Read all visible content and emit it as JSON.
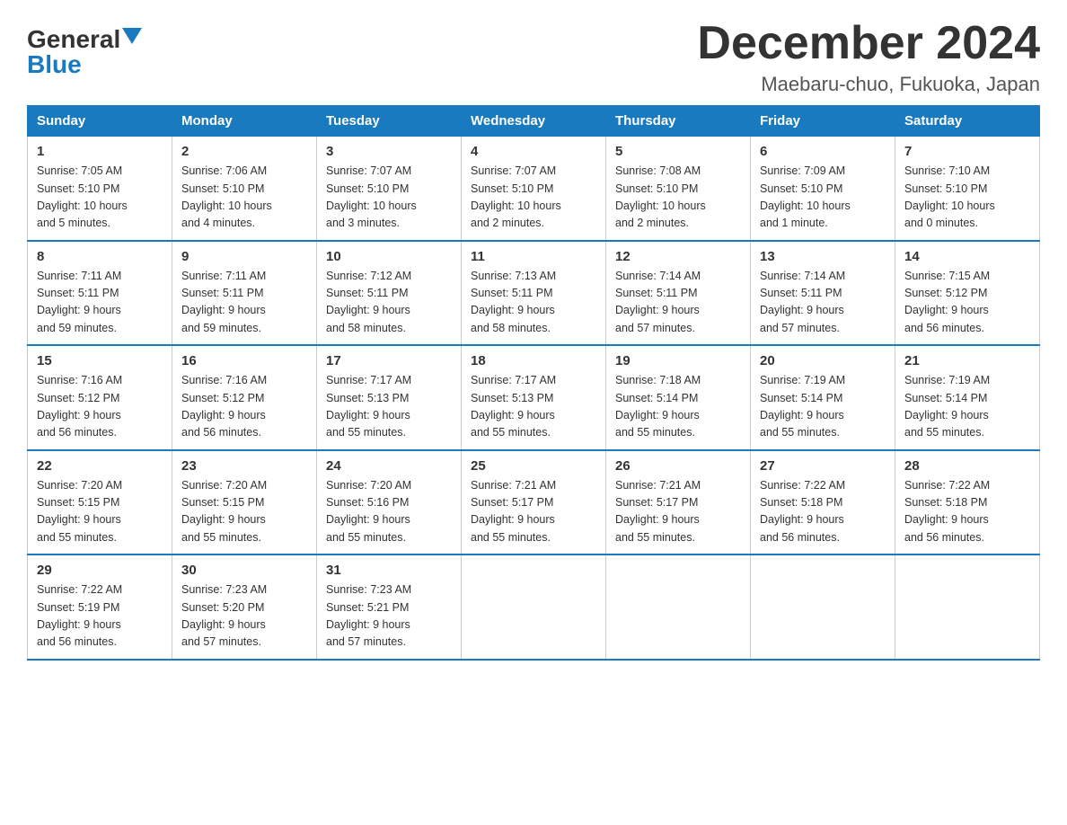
{
  "header": {
    "logo_general": "General",
    "logo_blue": "Blue",
    "title": "December 2024",
    "location": "Maebaru-chuo, Fukuoka, Japan"
  },
  "days_of_week": [
    "Sunday",
    "Monday",
    "Tuesday",
    "Wednesday",
    "Thursday",
    "Friday",
    "Saturday"
  ],
  "weeks": [
    [
      {
        "day": "1",
        "info": "Sunrise: 7:05 AM\nSunset: 5:10 PM\nDaylight: 10 hours\nand 5 minutes."
      },
      {
        "day": "2",
        "info": "Sunrise: 7:06 AM\nSunset: 5:10 PM\nDaylight: 10 hours\nand 4 minutes."
      },
      {
        "day": "3",
        "info": "Sunrise: 7:07 AM\nSunset: 5:10 PM\nDaylight: 10 hours\nand 3 minutes."
      },
      {
        "day": "4",
        "info": "Sunrise: 7:07 AM\nSunset: 5:10 PM\nDaylight: 10 hours\nand 2 minutes."
      },
      {
        "day": "5",
        "info": "Sunrise: 7:08 AM\nSunset: 5:10 PM\nDaylight: 10 hours\nand 2 minutes."
      },
      {
        "day": "6",
        "info": "Sunrise: 7:09 AM\nSunset: 5:10 PM\nDaylight: 10 hours\nand 1 minute."
      },
      {
        "day": "7",
        "info": "Sunrise: 7:10 AM\nSunset: 5:10 PM\nDaylight: 10 hours\nand 0 minutes."
      }
    ],
    [
      {
        "day": "8",
        "info": "Sunrise: 7:11 AM\nSunset: 5:11 PM\nDaylight: 9 hours\nand 59 minutes."
      },
      {
        "day": "9",
        "info": "Sunrise: 7:11 AM\nSunset: 5:11 PM\nDaylight: 9 hours\nand 59 minutes."
      },
      {
        "day": "10",
        "info": "Sunrise: 7:12 AM\nSunset: 5:11 PM\nDaylight: 9 hours\nand 58 minutes."
      },
      {
        "day": "11",
        "info": "Sunrise: 7:13 AM\nSunset: 5:11 PM\nDaylight: 9 hours\nand 58 minutes."
      },
      {
        "day": "12",
        "info": "Sunrise: 7:14 AM\nSunset: 5:11 PM\nDaylight: 9 hours\nand 57 minutes."
      },
      {
        "day": "13",
        "info": "Sunrise: 7:14 AM\nSunset: 5:11 PM\nDaylight: 9 hours\nand 57 minutes."
      },
      {
        "day": "14",
        "info": "Sunrise: 7:15 AM\nSunset: 5:12 PM\nDaylight: 9 hours\nand 56 minutes."
      }
    ],
    [
      {
        "day": "15",
        "info": "Sunrise: 7:16 AM\nSunset: 5:12 PM\nDaylight: 9 hours\nand 56 minutes."
      },
      {
        "day": "16",
        "info": "Sunrise: 7:16 AM\nSunset: 5:12 PM\nDaylight: 9 hours\nand 56 minutes."
      },
      {
        "day": "17",
        "info": "Sunrise: 7:17 AM\nSunset: 5:13 PM\nDaylight: 9 hours\nand 55 minutes."
      },
      {
        "day": "18",
        "info": "Sunrise: 7:17 AM\nSunset: 5:13 PM\nDaylight: 9 hours\nand 55 minutes."
      },
      {
        "day": "19",
        "info": "Sunrise: 7:18 AM\nSunset: 5:14 PM\nDaylight: 9 hours\nand 55 minutes."
      },
      {
        "day": "20",
        "info": "Sunrise: 7:19 AM\nSunset: 5:14 PM\nDaylight: 9 hours\nand 55 minutes."
      },
      {
        "day": "21",
        "info": "Sunrise: 7:19 AM\nSunset: 5:14 PM\nDaylight: 9 hours\nand 55 minutes."
      }
    ],
    [
      {
        "day": "22",
        "info": "Sunrise: 7:20 AM\nSunset: 5:15 PM\nDaylight: 9 hours\nand 55 minutes."
      },
      {
        "day": "23",
        "info": "Sunrise: 7:20 AM\nSunset: 5:15 PM\nDaylight: 9 hours\nand 55 minutes."
      },
      {
        "day": "24",
        "info": "Sunrise: 7:20 AM\nSunset: 5:16 PM\nDaylight: 9 hours\nand 55 minutes."
      },
      {
        "day": "25",
        "info": "Sunrise: 7:21 AM\nSunset: 5:17 PM\nDaylight: 9 hours\nand 55 minutes."
      },
      {
        "day": "26",
        "info": "Sunrise: 7:21 AM\nSunset: 5:17 PM\nDaylight: 9 hours\nand 55 minutes."
      },
      {
        "day": "27",
        "info": "Sunrise: 7:22 AM\nSunset: 5:18 PM\nDaylight: 9 hours\nand 56 minutes."
      },
      {
        "day": "28",
        "info": "Sunrise: 7:22 AM\nSunset: 5:18 PM\nDaylight: 9 hours\nand 56 minutes."
      }
    ],
    [
      {
        "day": "29",
        "info": "Sunrise: 7:22 AM\nSunset: 5:19 PM\nDaylight: 9 hours\nand 56 minutes."
      },
      {
        "day": "30",
        "info": "Sunrise: 7:23 AM\nSunset: 5:20 PM\nDaylight: 9 hours\nand 57 minutes."
      },
      {
        "day": "31",
        "info": "Sunrise: 7:23 AM\nSunset: 5:21 PM\nDaylight: 9 hours\nand 57 minutes."
      },
      {
        "day": "",
        "info": ""
      },
      {
        "day": "",
        "info": ""
      },
      {
        "day": "",
        "info": ""
      },
      {
        "day": "",
        "info": ""
      }
    ]
  ]
}
